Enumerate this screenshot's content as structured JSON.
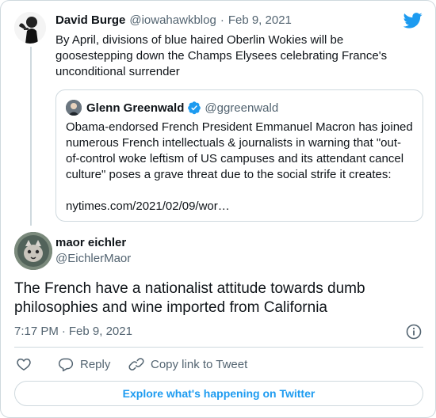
{
  "parent_tweet": {
    "author_name": "David Burge",
    "author_handle": "@iowahawkblog",
    "separator": "·",
    "date": "Feb 9, 2021",
    "text": "By April, divisions of blue haired Oberlin Wokies will be goosestepping down the Champs Elysees celebrating France's unconditional surrender",
    "quoted_tweet": {
      "author_name": "Glenn Greenwald",
      "author_handle": "@ggreenwald",
      "text": "Obama-endorsed French President Emmanuel Macron has joined numerous French intellectuals & journalists in warning that \"out-of-control woke leftism of US campuses and its attendant cancel culture\" poses a grave threat due to the social strife it creates:",
      "link": "nytimes.com/2021/02/09/wor…"
    }
  },
  "main_tweet": {
    "author_name": "maor eichler",
    "author_handle": "@EichlerMaor",
    "text": "The French have a nationalist attitude towards dumb philosophies and wine imported from California",
    "time": "7:17 PM",
    "separator": "·",
    "date": "Feb 9, 2021"
  },
  "actions": {
    "reply_label": "Reply",
    "copy_link_label": "Copy link to Tweet"
  },
  "explore_label": "Explore what's happening on Twitter",
  "icons": {
    "brand": "twitter-bird-icon",
    "verified": "verified-badge-icon",
    "info": "info-icon",
    "like": "heart-icon",
    "reply": "reply-bubble-icon",
    "copy_link": "link-icon"
  },
  "colors": {
    "twitter_blue": "#1d9bf0",
    "text_primary": "#0f1419",
    "text_secondary": "#536471",
    "border": "#cfd9de"
  }
}
